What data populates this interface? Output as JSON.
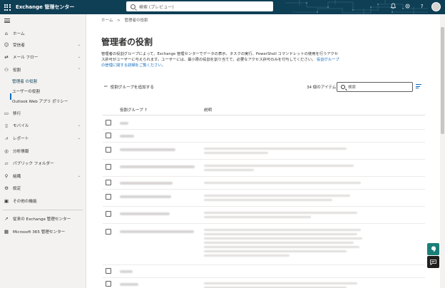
{
  "header": {
    "app_title": "Exchange 管理センター",
    "search_placeholder": "検索 (プレビュー)"
  },
  "sidebar": {
    "items": [
      {
        "label": "ホーム",
        "icon": "home-icon"
      },
      {
        "label": "受信者",
        "icon": "recipients-icon"
      },
      {
        "label": "メール フロー",
        "icon": "mail-flow-icon"
      },
      {
        "label": "役割",
        "icon": "roles-icon"
      },
      {
        "label": "移行",
        "icon": "migration-icon"
      },
      {
        "label": "モバイル",
        "icon": "mobile-icon"
      },
      {
        "label": "レポート",
        "icon": "reports-icon"
      },
      {
        "label": "分析情報",
        "icon": "insights-icon"
      },
      {
        "label": "パブリック フォルダー",
        "icon": "public-folder-icon"
      },
      {
        "label": "組織",
        "icon": "organization-icon"
      },
      {
        "label": "設定",
        "icon": "settings-icon"
      },
      {
        "label": "その他の機能",
        "icon": "other-features-icon"
      },
      {
        "label": "従来の Exchange 管理センター",
        "icon": "classic-eac-icon"
      },
      {
        "label": "Microsoft 365 管理センター",
        "icon": "m365-admin-icon"
      }
    ],
    "subitems": [
      {
        "label": "管理者 の役割"
      },
      {
        "label": "ユーザーの役割"
      },
      {
        "label": "Outlook Web アプリ ポリシー"
      }
    ]
  },
  "breadcrumb": {
    "home": "ホーム",
    "current": "管理者の役割"
  },
  "page": {
    "title": "管理者の役割",
    "description": "管理者の役割グループによって、Exchange 管理センターでデータの表示、タスクの実行、PowerShell コマンドレットの使用を行うアクセス許可がユーザーに与えられます。ユーザーには、最小限の役割を割り当てて、必要なアクセス許可のみを付与してください。",
    "description_link": "役割グループの管理に関する詳細をご覧ください。"
  },
  "toolbar": {
    "add_group_label": "役割グループを追加する",
    "item_count": "34 個のアイテム",
    "search_placeholder": "検索"
  },
  "table": {
    "columns": [
      "役割グループ ↑",
      "説明"
    ]
  }
}
